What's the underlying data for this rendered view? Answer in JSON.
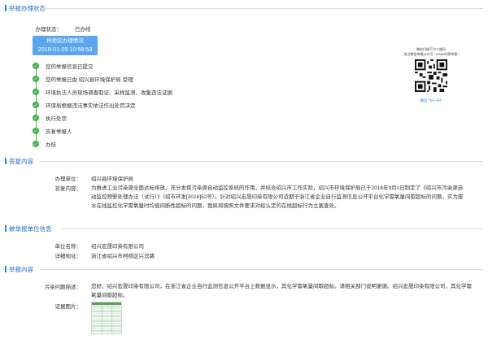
{
  "sections": {
    "status": "举报办理状态",
    "reply": "答复内容",
    "reported_unit": "被举报单位信息",
    "report_content": "举报内容"
  },
  "status": {
    "label": "办理状态：",
    "value": "已办结",
    "box_title": "柯桥区办理情况",
    "box_date": "2019-01-29 10:58:53"
  },
  "timeline": [
    "您的举报信息已提交",
    "您的举报已由 绍兴县环境保护局 受理",
    "环境执法人员现场调查取证、采样监测、收集违法证据",
    "环保局根据违法事实依法作出处罚决定",
    "执行处罚",
    "答复举报人",
    "办结"
  ],
  "qr": {
    "note_line1": "微信扫描下方二维码",
    "note_line2": "关注微信举报公众号 \"12369环保举报\"",
    "caption": "微信 \"扫一扫\""
  },
  "reply": {
    "unit_label": "办理单位：",
    "unit_value": "绍兴县环境保护局",
    "content_label": "答复内容：",
    "content_value": "为推进工业污染源全面达标排放，充分发挥污染源自动监控系统的作用，并结合绍兴市工作实际，绍兴市环境保护局已于2016年9月1日制定了《绍兴市污染源自动监控预警处理办法（试行）》（绍市环发[2016]52号）。针对绍兴宏晟印染有限公司近期于浙江省企业自行监测信息公开平台化学需氧量间歇超标的问题，实为废水在线监控化学需氧量时均值间断性超标的问题，我局将按照文件要求对经认定的在线超标行为立案查处。"
  },
  "reported_unit": {
    "name_label": "单位名称：",
    "name_value": "绍兴宏晟印染有限公司",
    "address_label": "详细地址：",
    "address_value": "浙江省绍兴市柯桥区兴滨路"
  },
  "report_content": {
    "desc_label": "污染问题描述：",
    "desc_value": "您好。绍兴宏晟印染有限公司，在浙江省企业自行监测信息公开平台上数据显示，其化学需氧量间歇超标。请相关部门说明谢谢。绍兴宏晟印染有限公司，其化学需氧量间歇超标。",
    "evidence_label": "证据图片："
  },
  "colors": {
    "accent": "#1e88e5",
    "success": "#3cb44b",
    "status_box": "#5aa7f0"
  }
}
